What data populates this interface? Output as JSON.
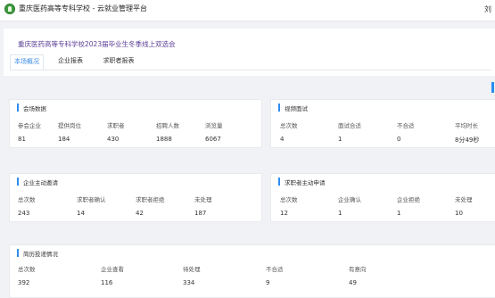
{
  "header": {
    "app_title": "重庆医药高等专科学校 - 云就业管理平台",
    "user_name": "刘"
  },
  "fair": {
    "title": "重庆医药高等专科学校2023届毕业生冬季线上双选会"
  },
  "tabs": [
    {
      "label": "本场概况",
      "active": true
    },
    {
      "label": "企业报表",
      "active": false
    },
    {
      "label": "求职者报表",
      "active": false
    }
  ],
  "venue_data": {
    "title": "会场数据",
    "stats": [
      {
        "label": "参会企业",
        "value": "81"
      },
      {
        "label": "提供岗位",
        "value": "184"
      },
      {
        "label": "求职者",
        "value": "430"
      },
      {
        "label": "招聘人数",
        "value": "1888"
      },
      {
        "label": "浏览量",
        "value": "6067"
      }
    ]
  },
  "video_interview": {
    "title": "视频面试",
    "stats": [
      {
        "label": "总次数",
        "value": "4"
      },
      {
        "label": "面试合适",
        "value": "1"
      },
      {
        "label": "不合适",
        "value": "0"
      },
      {
        "label": "平均时长",
        "value": "8分49秒"
      }
    ]
  },
  "company_invites": {
    "title": "企业主动邀请",
    "stats": [
      {
        "label": "总次数",
        "value": "243"
      },
      {
        "label": "求职者确认",
        "value": "14"
      },
      {
        "label": "求职者拒绝",
        "value": "42"
      },
      {
        "label": "未处理",
        "value": "187"
      }
    ]
  },
  "applicant_requests": {
    "title": "求职者主动申请",
    "stats": [
      {
        "label": "总次数",
        "value": "12"
      },
      {
        "label": "企业确认",
        "value": "1"
      },
      {
        "label": "企业拒绝",
        "value": "1"
      },
      {
        "label": "未处理",
        "value": "10"
      }
    ]
  },
  "resume_delivery": {
    "title": "简历投递情况",
    "stats": [
      {
        "label": "总次数",
        "value": "392"
      },
      {
        "label": "企业查看",
        "value": "116"
      },
      {
        "label": "待处理",
        "value": "334"
      },
      {
        "label": "不合适",
        "value": "9"
      },
      {
        "label": "有意向",
        "value": "49"
      }
    ]
  },
  "colors": {
    "accent": "#2d8cf0",
    "fair_title": "#5a3e96",
    "active_tab": "#3a8ee6",
    "logo": "#3d9a3f"
  }
}
